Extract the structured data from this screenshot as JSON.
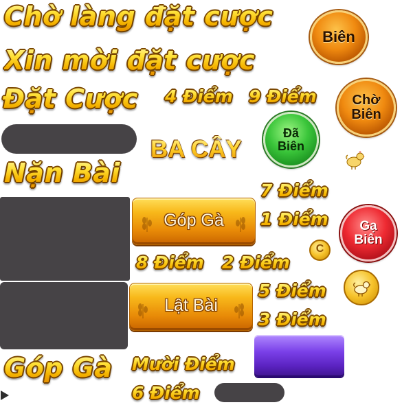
{
  "headings": {
    "waiting_dealer_bet": "Chờ làng đặt cược",
    "please_bet": "Xin mời đặt cược",
    "place_bet": "Đặt Cược",
    "squeeze_cards": "Nặn Bài",
    "pot_contribution": "Góp Gà",
    "ba_cay": "BA CÂY"
  },
  "points": {
    "p4": "4 Điểm",
    "p9": "9 Điểm",
    "p7": "7 Điểm",
    "p1": "1 Điểm",
    "p8": "8 Điểm",
    "p2": "2 Điểm",
    "p5": "5 Điểm",
    "p3": "3 Điểm",
    "p10": "Mười Điểm",
    "p6": "6 Điểm"
  },
  "buttons": {
    "gop_ga": "Góp Gà",
    "lat_bai": "Lật Bài"
  },
  "badges": {
    "bien": "Biên",
    "cho_bien_line1": "Chờ",
    "cho_bien_line2": "Biên",
    "da_bien_line1": "Đã",
    "da_bien_line2": "Biên",
    "ga_bien_line1": "Gạ",
    "ga_bien_line2": "Biên"
  },
  "coin_letter": "C",
  "icons": [
    "chicken-icon",
    "coin-icon",
    "chicken-coin-icon",
    "play-arrow-icon",
    "wheat-icon"
  ],
  "colors": {
    "gold_top": "#fff7a8",
    "gold_mid": "#ffe23a",
    "gold_bottom": "#e58f00",
    "placeholder_grey": "#464346",
    "badge_orange": "#f08a10",
    "badge_green": "#3ac53a",
    "badge_red": "#ee2a32",
    "purple_button": "#7a40e8"
  }
}
